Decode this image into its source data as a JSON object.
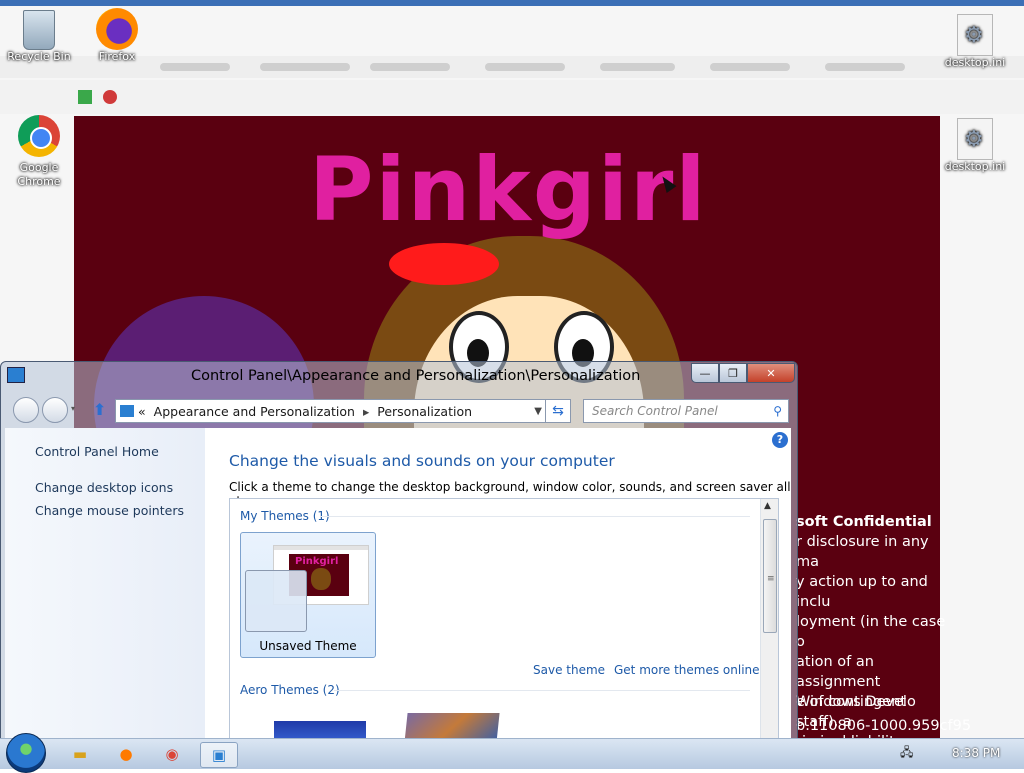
{
  "desktop": {
    "icons": [
      {
        "label": "Recycle Bin"
      },
      {
        "label": "Firefox"
      },
      {
        "label": "Google Chrome"
      },
      {
        "label": "desktop.ini"
      },
      {
        "label": "desktop.ini"
      }
    ]
  },
  "wallpaper": {
    "title": "Pinkgirl",
    "confidential_heading": "soft Confidential",
    "confidential_lines": [
      "r disclosure in any ma",
      "y action up to and inclu",
      "loyment (in the case o",
      "ation of an assignment",
      "e of contingent staff), a",
      "riminal liability."
    ],
    "windows_line": "Windows Develo",
    "build_line": "b.110806-1000.959cf95"
  },
  "window": {
    "title": "Control Panel\\Appearance and Personalization\\Personalization",
    "address": {
      "chevrons": "«",
      "crumb1": "Appearance and Personalization",
      "sep": "▸",
      "crumb2": "Personalization"
    },
    "search_placeholder": "Search Control Panel",
    "help": "?",
    "caption": {
      "min": "—",
      "max": "❐",
      "close": "✕"
    }
  },
  "leftnav": {
    "home": "Control Panel Home",
    "links": [
      "Change desktop icons",
      "Change mouse pointers"
    ]
  },
  "main": {
    "heading": "Change the visuals and sounds on your computer",
    "description": "Click a theme to change the desktop background, window color, sounds, and screen saver all at once.",
    "my_themes_label": "My Themes (1)",
    "unsaved_theme_label": "Unsaved Theme",
    "thumb_title": "Pinkgirl",
    "save_theme": "Save theme",
    "get_more": "Get more themes online",
    "aero_label": "Aero Themes (2)"
  },
  "taskbar": {
    "clock": "8:38 PM"
  }
}
